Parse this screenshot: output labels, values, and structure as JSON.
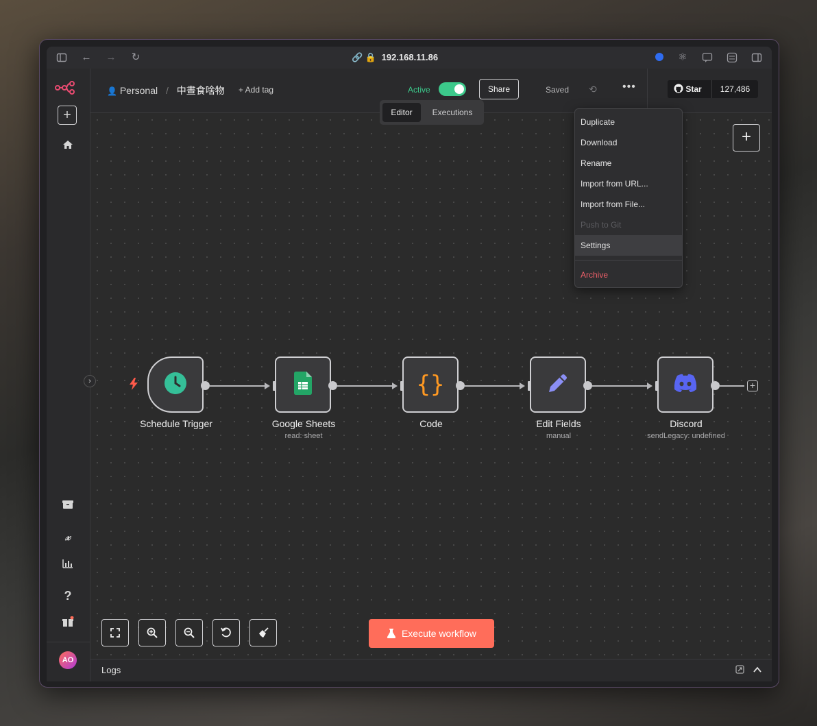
{
  "browser": {
    "url": "192.168.11.86"
  },
  "header": {
    "project": "Personal",
    "workflow_name": "中晝食啥物",
    "add_tag": "+ Add tag",
    "active_label": "Active",
    "share_label": "Share",
    "saved_label": "Saved",
    "github_star": "Star",
    "github_count": "127,486"
  },
  "tabs": [
    "Editor",
    "Executions"
  ],
  "menu": {
    "items": [
      "Duplicate",
      "Download",
      "Rename",
      "Import from URL...",
      "Import from File...",
      "Push to Git",
      "Settings"
    ],
    "danger": "Archive"
  },
  "nodes": [
    {
      "label": "Schedule Trigger",
      "sub": ""
    },
    {
      "label": "Google Sheets",
      "sub": "read: sheet"
    },
    {
      "label": "Code",
      "sub": ""
    },
    {
      "label": "Edit Fields",
      "sub": "manual"
    },
    {
      "label": "Discord",
      "sub": "sendLegacy: undefined"
    }
  ],
  "execute_label": "Execute workflow",
  "logs_label": "Logs",
  "avatar_initials": "AO",
  "colors": {
    "accent": "#ff6d5a",
    "active_green": "#3cc98b",
    "danger": "#f0606a"
  }
}
